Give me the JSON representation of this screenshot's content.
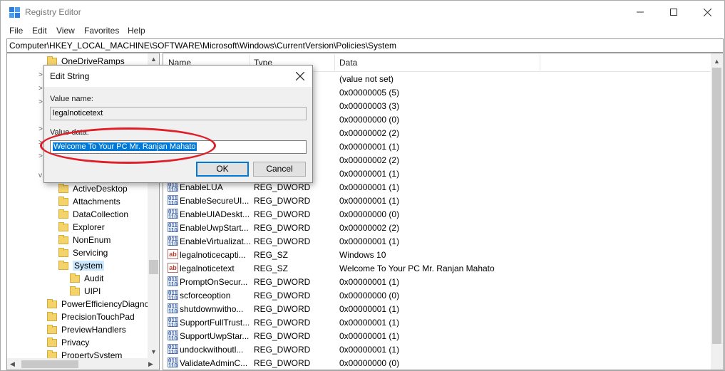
{
  "window": {
    "title": "Registry Editor"
  },
  "menu": [
    "File",
    "Edit",
    "View",
    "Favorites",
    "Help"
  ],
  "address": "Computer\\HKEY_LOCAL_MACHINE\\SOFTWARE\\Microsoft\\Windows\\CurrentVersion\\Policies\\System",
  "tree": [
    {
      "label": "OneDriveRamps",
      "indent": 0,
      "arrow": ""
    },
    {
      "label": "ActiveDesktop",
      "indent": 1,
      "arrow": ""
    },
    {
      "label": "Attachments",
      "indent": 1,
      "arrow": ""
    },
    {
      "label": "DataCollection",
      "indent": 1,
      "arrow": ">"
    },
    {
      "label": "Explorer",
      "indent": 1,
      "arrow": ""
    },
    {
      "label": "NonEnum",
      "indent": 1,
      "arrow": ""
    },
    {
      "label": "Servicing",
      "indent": 1,
      "arrow": ""
    },
    {
      "label": "System",
      "indent": 1,
      "arrow": "v"
    },
    {
      "label": "Audit",
      "indent": 2,
      "arrow": ""
    },
    {
      "label": "UIPI",
      "indent": 2,
      "arrow": ">"
    },
    {
      "label": "PowerEfficiencyDiagnc",
      "indent": 0,
      "arrow": ""
    },
    {
      "label": "PrecisionTouchPad",
      "indent": 0,
      "arrow": ""
    },
    {
      "label": "PreviewHandlers",
      "indent": 0,
      "arrow": ""
    },
    {
      "label": "Privacy",
      "indent": 0,
      "arrow": ""
    },
    {
      "label": "PropertySystem",
      "indent": 0,
      "arrow": ""
    }
  ],
  "list": {
    "columns": [
      "Name",
      "Type",
      "Data"
    ],
    "rows": [
      {
        "name": "",
        "type": "",
        "data": "(value not set)",
        "icon": ""
      },
      {
        "name": "",
        "type": "",
        "data": "0x00000005 (5)",
        "icon": ""
      },
      {
        "name": "",
        "type": "",
        "data": "0x00000003 (3)",
        "icon": ""
      },
      {
        "name": "",
        "type": "",
        "data": "0x00000000 (0)",
        "icon": ""
      },
      {
        "name": "",
        "type": "",
        "data": "0x00000002 (2)",
        "icon": ""
      },
      {
        "name": "",
        "type": "",
        "data": "0x00000001 (1)",
        "icon": ""
      },
      {
        "name": "",
        "type": "",
        "data": "0x00000002 (2)",
        "icon": ""
      },
      {
        "name": "",
        "type": "",
        "data": "0x00000001 (1)",
        "icon": ""
      },
      {
        "name": "EnableLUA",
        "type": "REG_DWORD",
        "data": "0x00000001 (1)",
        "icon": "dword"
      },
      {
        "name": "EnableSecureUI...",
        "type": "REG_DWORD",
        "data": "0x00000001 (1)",
        "icon": "dword"
      },
      {
        "name": "EnableUIADeskt...",
        "type": "REG_DWORD",
        "data": "0x00000000 (0)",
        "icon": "dword"
      },
      {
        "name": "EnableUwpStart...",
        "type": "REG_DWORD",
        "data": "0x00000002 (2)",
        "icon": "dword"
      },
      {
        "name": "EnableVirtualizat...",
        "type": "REG_DWORD",
        "data": "0x00000001 (1)",
        "icon": "dword"
      },
      {
        "name": "legalnoticecapti...",
        "type": "REG_SZ",
        "data": "Windows 10",
        "icon": "sz"
      },
      {
        "name": "legalnoticetext",
        "type": "REG_SZ",
        "data": "Welcome To Your PC Mr. Ranjan Mahato",
        "icon": "sz"
      },
      {
        "name": "PromptOnSecur...",
        "type": "REG_DWORD",
        "data": "0x00000001 (1)",
        "icon": "dword"
      },
      {
        "name": "scforceoption",
        "type": "REG_DWORD",
        "data": "0x00000000 (0)",
        "icon": "dword"
      },
      {
        "name": "shutdownwitho...",
        "type": "REG_DWORD",
        "data": "0x00000001 (1)",
        "icon": "dword"
      },
      {
        "name": "SupportFullTrust...",
        "type": "REG_DWORD",
        "data": "0x00000001 (1)",
        "icon": "dword"
      },
      {
        "name": "SupportUwpStar...",
        "type": "REG_DWORD",
        "data": "0x00000001 (1)",
        "icon": "dword"
      },
      {
        "name": "undockwithoutl...",
        "type": "REG_DWORD",
        "data": "0x00000001 (1)",
        "icon": "dword"
      },
      {
        "name": "ValidateAdminC...",
        "type": "REG_DWORD",
        "data": "0x00000000 (0)",
        "icon": "dword"
      }
    ]
  },
  "dialog": {
    "title": "Edit String",
    "value_name_label": "Value name:",
    "value_name": "legalnoticetext",
    "value_data_label": "Value data:",
    "value_data": "Welcome To Your PC Mr. Ranjan Mahato",
    "ok_label": "OK",
    "cancel_label": "Cancel"
  },
  "colors": {
    "selection": "#0078d7",
    "highlight_ring": "#e01e28",
    "folder": "#f5d36b"
  }
}
